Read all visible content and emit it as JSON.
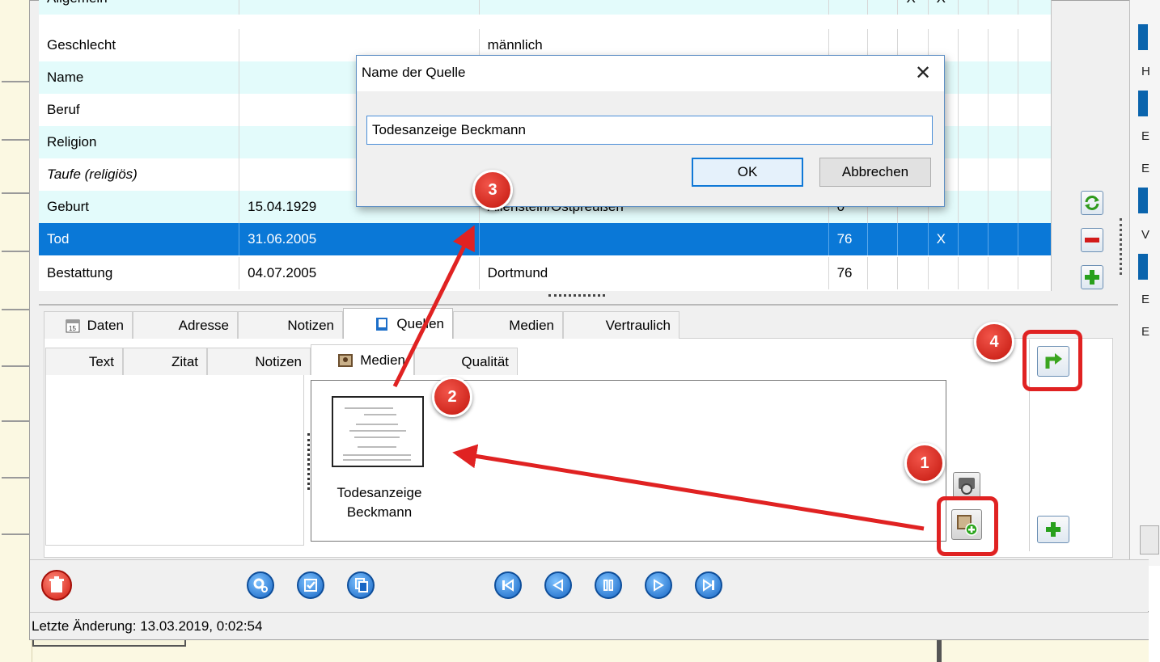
{
  "table": {
    "rows": [
      {
        "label": "Allgemein",
        "date": "",
        "place": "",
        "age": "",
        "m1": "",
        "m2": "X",
        "m3": "X",
        "m4": "",
        "m5": "",
        "m6": ""
      },
      {
        "label": "Geschlecht",
        "date": "",
        "place": "männlich",
        "age": "",
        "m1": "",
        "m2": "",
        "m3": "",
        "m4": "",
        "m5": "",
        "m6": ""
      },
      {
        "label": "Name",
        "date": "",
        "place": "",
        "age": "",
        "m1": "",
        "m2": "",
        "m3": "",
        "m4": "",
        "m5": "",
        "m6": ""
      },
      {
        "label": "Beruf",
        "date": "",
        "place": "",
        "age": "",
        "m1": "",
        "m2": "",
        "m3": "",
        "m4": "",
        "m5": "",
        "m6": ""
      },
      {
        "label": "Religion",
        "date": "",
        "place": "",
        "age": "",
        "m1": "",
        "m2": "",
        "m3": "",
        "m4": "",
        "m5": "",
        "m6": ""
      },
      {
        "label": "Taufe (religiös)",
        "date": "",
        "place": "",
        "age": "",
        "m1": "",
        "m2": "",
        "m3": "",
        "m4": "",
        "m5": "",
        "m6": ""
      },
      {
        "label": "Geburt",
        "date": "15.04.1929",
        "place": "Allenstein/Ostpreußen",
        "age": "0",
        "m1": "",
        "m2": "",
        "m3": "",
        "m4": "",
        "m5": "",
        "m6": ""
      },
      {
        "label": "Tod",
        "date": "31.06.2005",
        "place": "",
        "age": "76",
        "m1": "",
        "m2": "",
        "m3": "X",
        "m4": "",
        "m5": "",
        "m6": ""
      },
      {
        "label": "Bestattung",
        "date": "04.07.2005",
        "place": "Dortmund",
        "age": "76",
        "m1": "",
        "m2": "",
        "m3": "",
        "m4": "",
        "m5": "",
        "m6": ""
      }
    ]
  },
  "tabs": {
    "main": [
      "Daten",
      "Adresse",
      "Notizen",
      "Quellen",
      "Medien",
      "Vertraulich"
    ],
    "sub": [
      "Text",
      "Zitat",
      "Notizen",
      "Medien",
      "Qualität"
    ]
  },
  "media": {
    "caption_line1": "Todesanzeige",
    "caption_line2": "Beckmann"
  },
  "dialog": {
    "title": "Name der Quelle",
    "close": "✕",
    "input_value": "Todesanzeige Beckmann",
    "ok": "OK",
    "cancel": "Abbrechen"
  },
  "status": {
    "last_change": "Letzte Änderung: 13.03.2019, 0:02:54"
  },
  "markers": [
    "1",
    "2",
    "3",
    "4"
  ],
  "right_panel_chars": [
    "H",
    "E",
    "E",
    "V",
    "E",
    "E"
  ],
  "colors": {
    "selection": "#0a78d7",
    "row_alt": "#e3fbfb",
    "annotation_red": "#e02222",
    "toolbar_blue": "#1766c4"
  }
}
